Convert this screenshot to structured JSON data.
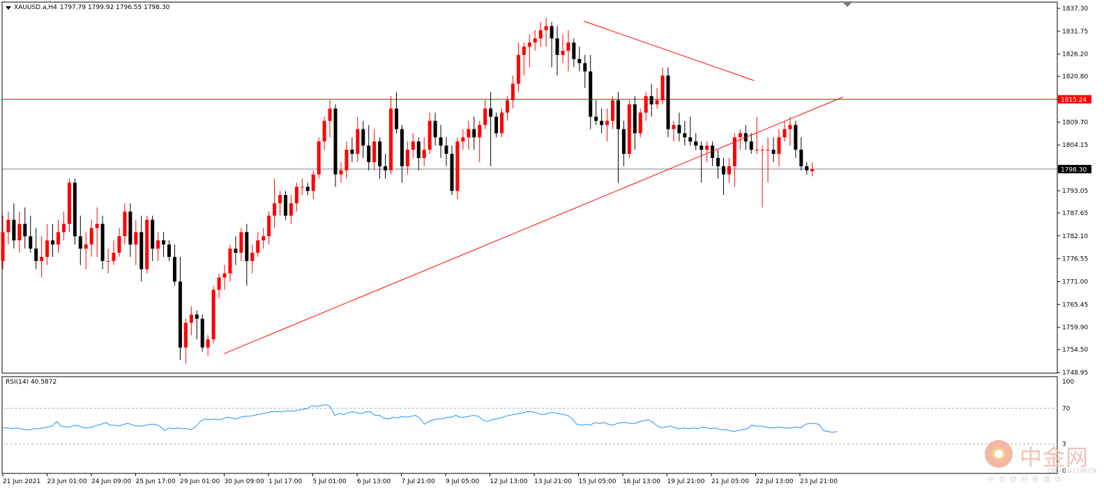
{
  "header": {
    "symbol": "XAUUSD.a,H4",
    "ohlc": "1797.79 1799.92 1796.55 1798.30"
  },
  "rsi": {
    "label": "RSI(14) 40.5872",
    "levels": [
      100,
      70,
      30,
      0
    ],
    "level_labels": [
      "100",
      "70",
      "3",
      "0"
    ]
  },
  "watermark": {
    "cn": "中金网",
    "en": "CNGOLD.COM.CN",
    "sub": "中文财经新媒体"
  },
  "colors": {
    "bull": "#ff0000",
    "bear": "#000000",
    "line": "#ff0000",
    "rsi": "#1e90ff",
    "price_line": "#708090",
    "grid_dotted": "#b0b0b0"
  },
  "chart_data": {
    "type": "candlestick",
    "ylim": [
      1748.95,
      1837.3
    ],
    "yticks": [
      1837.3,
      1831.75,
      1826.2,
      1820.8,
      1815.24,
      1809.7,
      1804.15,
      1798.3,
      1793.05,
      1787.65,
      1782.1,
      1776.55,
      1771.0,
      1765.45,
      1759.9,
      1754.5,
      1748.95
    ],
    "highlighted_levels": [
      {
        "value": 1815.24,
        "label": "1815.24",
        "kind": "horizontal_resistance",
        "color": "#ff0000"
      },
      {
        "value": 1798.3,
        "label": "1798.30",
        "kind": "current_price",
        "color": "#708090"
      }
    ],
    "xticks": [
      "21 Jun 2021",
      "23 Jun 01:00",
      "24 Jun 09:00",
      "25 Jun 17:00",
      "29 Jun 01:00",
      "30 Jun 09:00",
      "1 Jul 17:00",
      "5 Jul 01:00",
      "6 Jul 13:00",
      "7 Jul 21:00",
      "9 Jul 05:00",
      "12 Jul 13:00",
      "13 Jul 21:00",
      "15 Jul 05:00",
      "16 Jul 13:00",
      "19 Jul 21:00",
      "21 Jul 05:00",
      "22 Jul 13:00",
      "23 Jul 21:00"
    ],
    "trendlines": [
      {
        "name": "rising",
        "from": {
          "bar": 0.0,
          "price": 1753.5
        },
        "to": {
          "bar": 0.0,
          "price": 1815.8
        }
      },
      {
        "name": "falling",
        "from": {
          "bar": 0.0,
          "price": 1834.2
        },
        "to": {
          "bar": 0.0,
          "price": 1819.8
        }
      }
    ],
    "candles": [
      {
        "o": 1776,
        "h": 1787,
        "l": 1774,
        "c": 1783
      },
      {
        "o": 1783,
        "h": 1788,
        "l": 1780,
        "c": 1786
      },
      {
        "o": 1786,
        "h": 1790,
        "l": 1779,
        "c": 1781
      },
      {
        "o": 1781,
        "h": 1788,
        "l": 1778,
        "c": 1785
      },
      {
        "o": 1785,
        "h": 1789,
        "l": 1779,
        "c": 1782
      },
      {
        "o": 1782,
        "h": 1787,
        "l": 1778,
        "c": 1779
      },
      {
        "o": 1779,
        "h": 1784,
        "l": 1774,
        "c": 1776
      },
      {
        "o": 1776,
        "h": 1782,
        "l": 1772,
        "c": 1777
      },
      {
        "o": 1777,
        "h": 1785,
        "l": 1775,
        "c": 1781
      },
      {
        "o": 1781,
        "h": 1785,
        "l": 1777,
        "c": 1780
      },
      {
        "o": 1780,
        "h": 1786,
        "l": 1778,
        "c": 1783
      },
      {
        "o": 1783,
        "h": 1788,
        "l": 1781,
        "c": 1785
      },
      {
        "o": 1785,
        "h": 1796,
        "l": 1783,
        "c": 1795
      },
      {
        "o": 1795,
        "h": 1796,
        "l": 1780,
        "c": 1782
      },
      {
        "o": 1782,
        "h": 1787,
        "l": 1775,
        "c": 1779
      },
      {
        "o": 1779,
        "h": 1783,
        "l": 1774,
        "c": 1780
      },
      {
        "o": 1780,
        "h": 1786,
        "l": 1777,
        "c": 1784
      },
      {
        "o": 1784,
        "h": 1789,
        "l": 1777,
        "c": 1785
      },
      {
        "o": 1785,
        "h": 1787,
        "l": 1774,
        "c": 1776
      },
      {
        "o": 1776,
        "h": 1779,
        "l": 1773,
        "c": 1776
      },
      {
        "o": 1776,
        "h": 1781,
        "l": 1775,
        "c": 1778
      },
      {
        "o": 1778,
        "h": 1784,
        "l": 1777,
        "c": 1782
      },
      {
        "o": 1782,
        "h": 1790,
        "l": 1780,
        "c": 1788
      },
      {
        "o": 1788,
        "h": 1790,
        "l": 1777,
        "c": 1780
      },
      {
        "o": 1780,
        "h": 1786,
        "l": 1775,
        "c": 1783
      },
      {
        "o": 1783,
        "h": 1787,
        "l": 1771,
        "c": 1774
      },
      {
        "o": 1774,
        "h": 1787,
        "l": 1773,
        "c": 1786
      },
      {
        "o": 1786,
        "h": 1787,
        "l": 1776,
        "c": 1779
      },
      {
        "o": 1779,
        "h": 1783,
        "l": 1776,
        "c": 1781
      },
      {
        "o": 1781,
        "h": 1783,
        "l": 1777,
        "c": 1780
      },
      {
        "o": 1780,
        "h": 1781,
        "l": 1776,
        "c": 1777
      },
      {
        "o": 1777,
        "h": 1780,
        "l": 1770,
        "c": 1771
      },
      {
        "o": 1771,
        "h": 1777,
        "l": 1752,
        "c": 1755
      },
      {
        "o": 1755,
        "h": 1762,
        "l": 1751,
        "c": 1761
      },
      {
        "o": 1761,
        "h": 1765,
        "l": 1758,
        "c": 1763
      },
      {
        "o": 1763,
        "h": 1764,
        "l": 1757,
        "c": 1762
      },
      {
        "o": 1762,
        "h": 1763,
        "l": 1754,
        "c": 1755
      },
      {
        "o": 1755,
        "h": 1758,
        "l": 1753,
        "c": 1757
      },
      {
        "o": 1757,
        "h": 1770,
        "l": 1756,
        "c": 1769
      },
      {
        "o": 1769,
        "h": 1773,
        "l": 1767,
        "c": 1772
      },
      {
        "o": 1772,
        "h": 1775,
        "l": 1769,
        "c": 1773
      },
      {
        "o": 1773,
        "h": 1780,
        "l": 1771,
        "c": 1779
      },
      {
        "o": 1779,
        "h": 1782,
        "l": 1775,
        "c": 1778
      },
      {
        "o": 1778,
        "h": 1784,
        "l": 1776,
        "c": 1783
      },
      {
        "o": 1783,
        "h": 1785,
        "l": 1770,
        "c": 1776
      },
      {
        "o": 1776,
        "h": 1780,
        "l": 1773,
        "c": 1778
      },
      {
        "o": 1778,
        "h": 1783,
        "l": 1777,
        "c": 1781
      },
      {
        "o": 1781,
        "h": 1784,
        "l": 1779,
        "c": 1782
      },
      {
        "o": 1782,
        "h": 1788,
        "l": 1780,
        "c": 1787
      },
      {
        "o": 1787,
        "h": 1796,
        "l": 1784,
        "c": 1790
      },
      {
        "o": 1790,
        "h": 1793,
        "l": 1787,
        "c": 1792
      },
      {
        "o": 1792,
        "h": 1793,
        "l": 1786,
        "c": 1787
      },
      {
        "o": 1787,
        "h": 1792,
        "l": 1785,
        "c": 1790
      },
      {
        "o": 1790,
        "h": 1795,
        "l": 1788,
        "c": 1794
      },
      {
        "o": 1794,
        "h": 1796,
        "l": 1792,
        "c": 1794
      },
      {
        "o": 1794,
        "h": 1795,
        "l": 1792,
        "c": 1793
      },
      {
        "o": 1793,
        "h": 1798,
        "l": 1791,
        "c": 1797
      },
      {
        "o": 1797,
        "h": 1806,
        "l": 1796,
        "c": 1805
      },
      {
        "o": 1805,
        "h": 1811,
        "l": 1803,
        "c": 1810
      },
      {
        "o": 1810,
        "h": 1815,
        "l": 1806,
        "c": 1813
      },
      {
        "o": 1813,
        "h": 1814,
        "l": 1794,
        "c": 1797
      },
      {
        "o": 1797,
        "h": 1800,
        "l": 1795,
        "c": 1798
      },
      {
        "o": 1798,
        "h": 1805,
        "l": 1796,
        "c": 1803
      },
      {
        "o": 1803,
        "h": 1806,
        "l": 1800,
        "c": 1802
      },
      {
        "o": 1802,
        "h": 1811,
        "l": 1800,
        "c": 1808
      },
      {
        "o": 1808,
        "h": 1810,
        "l": 1801,
        "c": 1804
      },
      {
        "o": 1804,
        "h": 1809,
        "l": 1798,
        "c": 1800
      },
      {
        "o": 1800,
        "h": 1808,
        "l": 1798,
        "c": 1805
      },
      {
        "o": 1805,
        "h": 1806,
        "l": 1796,
        "c": 1799
      },
      {
        "o": 1799,
        "h": 1802,
        "l": 1796,
        "c": 1798
      },
      {
        "o": 1798,
        "h": 1816,
        "l": 1797,
        "c": 1813
      },
      {
        "o": 1813,
        "h": 1817,
        "l": 1807,
        "c": 1808
      },
      {
        "o": 1808,
        "h": 1809,
        "l": 1795,
        "c": 1799
      },
      {
        "o": 1799,
        "h": 1805,
        "l": 1797,
        "c": 1803
      },
      {
        "o": 1803,
        "h": 1807,
        "l": 1801,
        "c": 1805
      },
      {
        "o": 1805,
        "h": 1806,
        "l": 1798,
        "c": 1801
      },
      {
        "o": 1801,
        "h": 1806,
        "l": 1799,
        "c": 1803
      },
      {
        "o": 1803,
        "h": 1812,
        "l": 1802,
        "c": 1810
      },
      {
        "o": 1810,
        "h": 1812,
        "l": 1804,
        "c": 1806
      },
      {
        "o": 1806,
        "h": 1809,
        "l": 1801,
        "c": 1804
      },
      {
        "o": 1804,
        "h": 1806,
        "l": 1799,
        "c": 1802
      },
      {
        "o": 1802,
        "h": 1804,
        "l": 1792,
        "c": 1793
      },
      {
        "o": 1793,
        "h": 1806,
        "l": 1791,
        "c": 1805
      },
      {
        "o": 1805,
        "h": 1808,
        "l": 1803,
        "c": 1806
      },
      {
        "o": 1806,
        "h": 1810,
        "l": 1803,
        "c": 1808
      },
      {
        "o": 1808,
        "h": 1811,
        "l": 1803,
        "c": 1806
      },
      {
        "o": 1806,
        "h": 1810,
        "l": 1800,
        "c": 1809
      },
      {
        "o": 1809,
        "h": 1815,
        "l": 1808,
        "c": 1813
      },
      {
        "o": 1813,
        "h": 1817,
        "l": 1799,
        "c": 1811
      },
      {
        "o": 1811,
        "h": 1812,
        "l": 1806,
        "c": 1807
      },
      {
        "o": 1807,
        "h": 1813,
        "l": 1806,
        "c": 1812
      },
      {
        "o": 1812,
        "h": 1816,
        "l": 1810,
        "c": 1815
      },
      {
        "o": 1815,
        "h": 1821,
        "l": 1813,
        "c": 1819
      },
      {
        "o": 1819,
        "h": 1829,
        "l": 1817,
        "c": 1826
      },
      {
        "o": 1826,
        "h": 1829,
        "l": 1821,
        "c": 1828
      },
      {
        "o": 1828,
        "h": 1831,
        "l": 1823,
        "c": 1829
      },
      {
        "o": 1829,
        "h": 1832,
        "l": 1827,
        "c": 1830
      },
      {
        "o": 1830,
        "h": 1834,
        "l": 1828,
        "c": 1832
      },
      {
        "o": 1832,
        "h": 1835,
        "l": 1828,
        "c": 1833
      },
      {
        "o": 1833,
        "h": 1834,
        "l": 1823,
        "c": 1830
      },
      {
        "o": 1830,
        "h": 1833,
        "l": 1821,
        "c": 1826
      },
      {
        "o": 1826,
        "h": 1831,
        "l": 1824,
        "c": 1827
      },
      {
        "o": 1827,
        "h": 1832,
        "l": 1822,
        "c": 1829
      },
      {
        "o": 1829,
        "h": 1830,
        "l": 1823,
        "c": 1825
      },
      {
        "o": 1825,
        "h": 1828,
        "l": 1822,
        "c": 1824
      },
      {
        "o": 1824,
        "h": 1826,
        "l": 1818,
        "c": 1822
      },
      {
        "o": 1822,
        "h": 1826,
        "l": 1808,
        "c": 1811
      },
      {
        "o": 1811,
        "h": 1815,
        "l": 1809,
        "c": 1810
      },
      {
        "o": 1810,
        "h": 1813,
        "l": 1807,
        "c": 1809
      },
      {
        "o": 1809,
        "h": 1813,
        "l": 1805,
        "c": 1810
      },
      {
        "o": 1810,
        "h": 1816,
        "l": 1808,
        "c": 1815
      },
      {
        "o": 1815,
        "h": 1817,
        "l": 1795,
        "c": 1808
      },
      {
        "o": 1808,
        "h": 1810,
        "l": 1799,
        "c": 1802
      },
      {
        "o": 1802,
        "h": 1815,
        "l": 1801,
        "c": 1814
      },
      {
        "o": 1814,
        "h": 1816,
        "l": 1803,
        "c": 1807
      },
      {
        "o": 1807,
        "h": 1813,
        "l": 1806,
        "c": 1812
      },
      {
        "o": 1812,
        "h": 1817,
        "l": 1810,
        "c": 1816
      },
      {
        "o": 1816,
        "h": 1819,
        "l": 1811,
        "c": 1814
      },
      {
        "o": 1814,
        "h": 1818,
        "l": 1813,
        "c": 1815
      },
      {
        "o": 1815,
        "h": 1823,
        "l": 1814,
        "c": 1821
      },
      {
        "o": 1821,
        "h": 1823,
        "l": 1806,
        "c": 1808
      },
      {
        "o": 1808,
        "h": 1810,
        "l": 1805,
        "c": 1809
      },
      {
        "o": 1809,
        "h": 1812,
        "l": 1805,
        "c": 1807
      },
      {
        "o": 1807,
        "h": 1810,
        "l": 1804,
        "c": 1806
      },
      {
        "o": 1806,
        "h": 1811,
        "l": 1804,
        "c": 1805
      },
      {
        "o": 1805,
        "h": 1807,
        "l": 1803,
        "c": 1804
      },
      {
        "o": 1804,
        "h": 1805,
        "l": 1795,
        "c": 1803
      },
      {
        "o": 1803,
        "h": 1805,
        "l": 1800,
        "c": 1804
      },
      {
        "o": 1804,
        "h": 1805,
        "l": 1799,
        "c": 1801
      },
      {
        "o": 1801,
        "h": 1803,
        "l": 1796,
        "c": 1799
      },
      {
        "o": 1799,
        "h": 1801,
        "l": 1792,
        "c": 1797
      },
      {
        "o": 1797,
        "h": 1801,
        "l": 1795,
        "c": 1799
      },
      {
        "o": 1799,
        "h": 1807,
        "l": 1794,
        "c": 1806
      },
      {
        "o": 1806,
        "h": 1808,
        "l": 1803,
        "c": 1807
      },
      {
        "o": 1807,
        "h": 1809,
        "l": 1803,
        "c": 1805
      },
      {
        "o": 1805,
        "h": 1807,
        "l": 1802,
        "c": 1803
      },
      {
        "o": 1803,
        "h": 1811,
        "l": 1802,
        "c": 1803
      },
      {
        "o": 1803,
        "h": 1804,
        "l": 1789,
        "c": 1803
      },
      {
        "o": 1803,
        "h": 1806,
        "l": 1795,
        "c": 1803
      },
      {
        "o": 1803,
        "h": 1806,
        "l": 1800,
        "c": 1802
      },
      {
        "o": 1802,
        "h": 1808,
        "l": 1799,
        "c": 1806
      },
      {
        "o": 1806,
        "h": 1810,
        "l": 1805,
        "c": 1808
      },
      {
        "o": 1808,
        "h": 1811,
        "l": 1804,
        "c": 1809
      },
      {
        "o": 1809,
        "h": 1810,
        "l": 1801,
        "c": 1803
      },
      {
        "o": 1803,
        "h": 1806,
        "l": 1798,
        "c": 1799
      },
      {
        "o": 1799,
        "h": 1800,
        "l": 1797,
        "c": 1798
      },
      {
        "o": 1797.79,
        "h": 1799.92,
        "l": 1796.55,
        "c": 1798.3
      }
    ],
    "rsi_ylim": [
      0,
      100
    ],
    "rsi_values": [
      48,
      48,
      47,
      48,
      47,
      46,
      46,
      47,
      47,
      48,
      49,
      50,
      55,
      50,
      49,
      49,
      51,
      50,
      48,
      48,
      49,
      51,
      52,
      54,
      51,
      51,
      50,
      52,
      53,
      51,
      50,
      50,
      51,
      52,
      52,
      50,
      45,
      48,
      47,
      48,
      47,
      47,
      46,
      49,
      55,
      58,
      57,
      58,
      57,
      58,
      60,
      59,
      58,
      60,
      61,
      61,
      62,
      63,
      64,
      65,
      66,
      66,
      66,
      67,
      67,
      67,
      68,
      69,
      70,
      73,
      72,
      73,
      74,
      72,
      62,
      64,
      63,
      65,
      66,
      65,
      64,
      66,
      66,
      62,
      62,
      59,
      58,
      60,
      59,
      61,
      60,
      61,
      62,
      59,
      52,
      55,
      57,
      58,
      58,
      60,
      60,
      62,
      60,
      60,
      61,
      62,
      61,
      57,
      55,
      57,
      58,
      59,
      61,
      62,
      63,
      64,
      65,
      66,
      66,
      65,
      63,
      63,
      65,
      65,
      64,
      63,
      62,
      58,
      52,
      51,
      52,
      51,
      54,
      53,
      54,
      52,
      51,
      53,
      54,
      54,
      53,
      53,
      55,
      56,
      57,
      54,
      50,
      48,
      49,
      50,
      48,
      47,
      48,
      47,
      48,
      47,
      49,
      48,
      47,
      48,
      46,
      46,
      45,
      44,
      45,
      46,
      47,
      51,
      50,
      50,
      49,
      48,
      48,
      49,
      48,
      48,
      48,
      49,
      48,
      52,
      53,
      53,
      52,
      45,
      44,
      43,
      44
    ]
  }
}
